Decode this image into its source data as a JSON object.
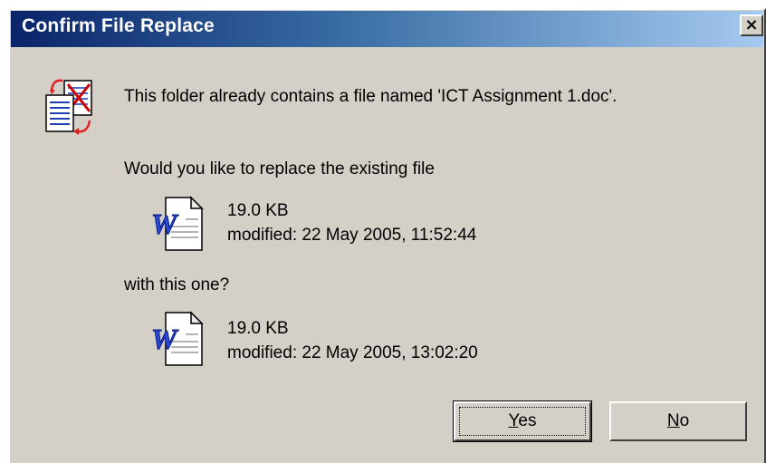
{
  "window": {
    "title": "Confirm File Replace",
    "close_label": "×"
  },
  "message": {
    "line1": "This folder already contains a file named 'ICT Assignment 1.doc'.",
    "line2": "Would you like to replace the existing file",
    "line3": "with this one?"
  },
  "existing_file": {
    "size": "19.0 KB",
    "modified": "modified: 22 May 2005, 11:52:44",
    "icon": "word-document-icon"
  },
  "new_file": {
    "size": "19.0 KB",
    "modified": "modified: 22 May 2005, 13:02:20",
    "icon": "word-document-icon"
  },
  "buttons": {
    "yes_mnemonic": "Y",
    "yes_rest": "es",
    "no_mnemonic": "N",
    "no_rest": "o"
  },
  "icons": {
    "header": "file-replace-icon"
  },
  "colors": {
    "face": "#d4d0c8",
    "title_start": "#0a246a",
    "title_end": "#a6caf0"
  }
}
